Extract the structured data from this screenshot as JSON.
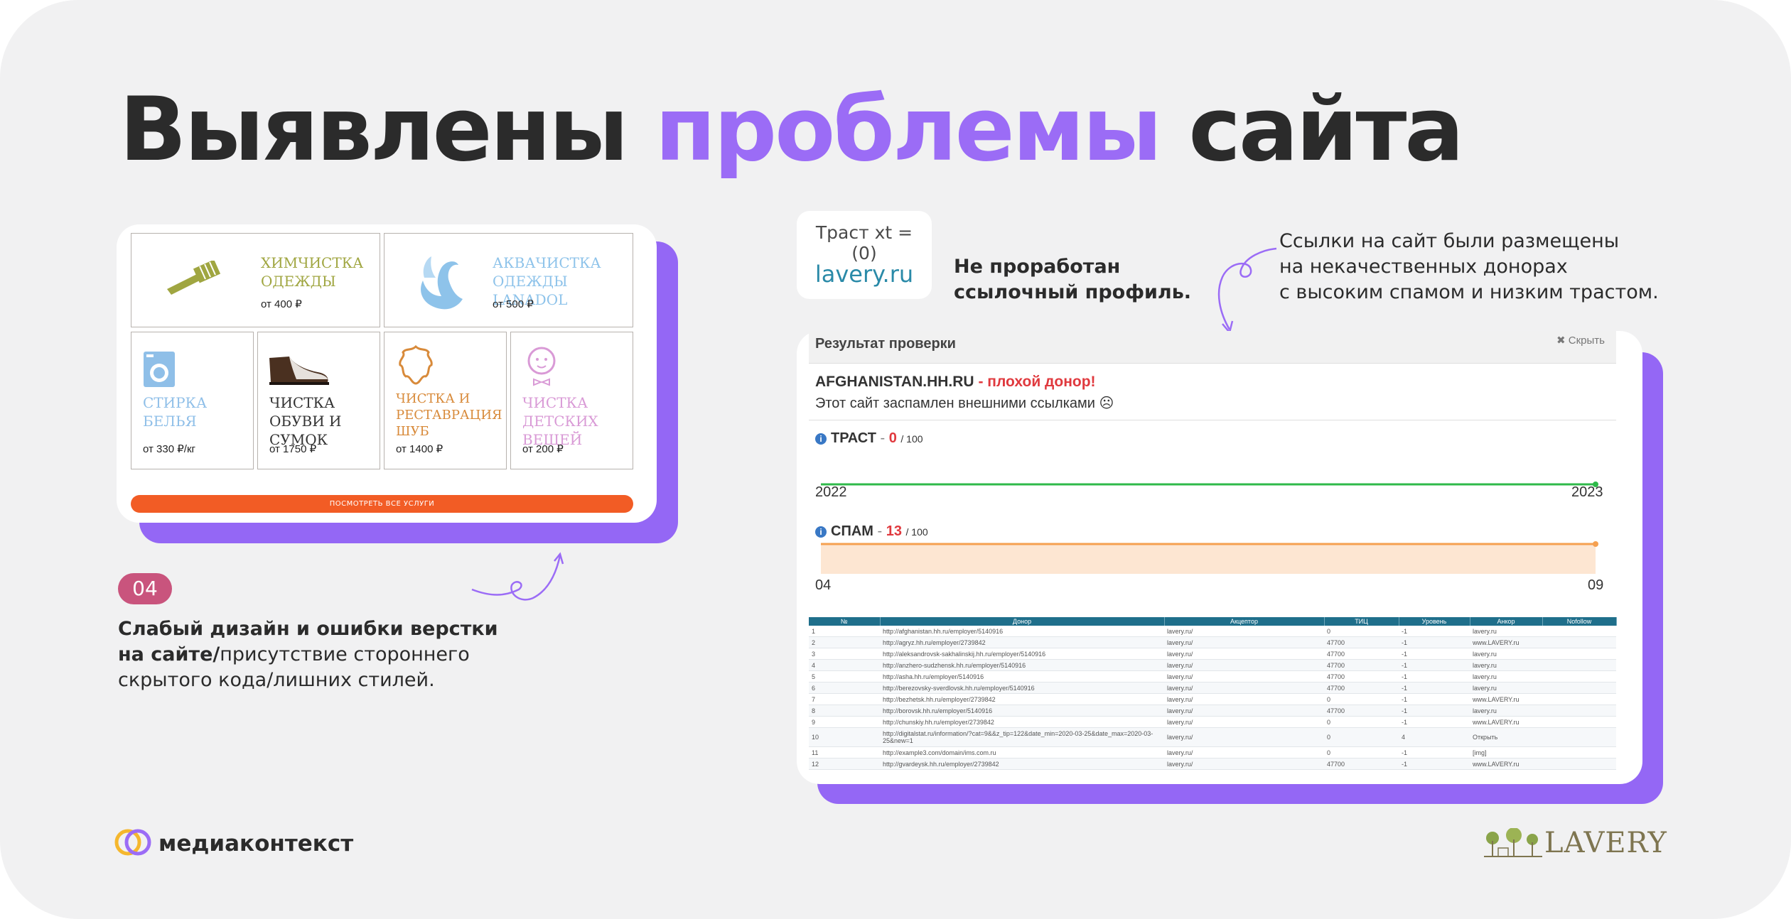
{
  "colors": {
    "background": "#f1f1f2",
    "accent": "#9b6cf6",
    "plate": "#9467f5",
    "badge": "#c9547d",
    "orange_button": "#f25c25",
    "bad": "#e0393e",
    "trust_line": "#2fba4a",
    "spam_line": "#f5a050",
    "spam_fill": "#fde6d2",
    "table_header": "#1f6f8b"
  },
  "heading": {
    "part1": "Выявлены ",
    "accent": "проблемы",
    "part2": " сайта"
  },
  "services": {
    "items": [
      {
        "name_line1": "ХИМЧИСТКА",
        "name_line2": "ОДЕЖДЫ",
        "price": "от 400 ₽",
        "color": "#a0a641",
        "icon": "brush-icon"
      },
      {
        "name_line1": "АКВАЧИСТКА",
        "name_line2": "ОДЕЖДЫ Lanadol",
        "price": "от 500 ₽",
        "color": "#8ec3ea",
        "icon": "swan-icon"
      },
      {
        "name_line1": "СТИРКА",
        "name_line2": "БЕЛЬЯ",
        "price": "от 330 ₽/кг",
        "color": "#8fbfe8",
        "icon": "washing-machine-icon"
      },
      {
        "name_line1": "ЧИСТКА",
        "name_line2": "ОБУВИ и СУМОК",
        "price": "от 1750 ₽",
        "color": "#333333",
        "icon": "shoe-icon"
      },
      {
        "name_line1": "ЧИСТКА И",
        "name_line2": "РЕСТАВРАЦИЯ",
        "name_line3": "ШУБ",
        "price": "от 1400 ₽",
        "color": "#d88a3a",
        "icon": "fur-hide-icon"
      },
      {
        "name_line1": "ЧИСТКА",
        "name_line2": "ДЕТСКИХ ВЕЩЕЙ",
        "price": "от 200 ₽",
        "color": "#d99ad6",
        "icon": "baby-icon"
      }
    ],
    "button_label": "ПОСМОТРЕТЬ ВСЕ УСЛУГИ"
  },
  "badge": "04",
  "desc": {
    "bold": "Слабый дизайн и ошибки верстки на сайте/",
    "normal": "присутствие стороннего скрытого кода/лишних стилей."
  },
  "trust": {
    "label": "Траст xt = (0)",
    "domain": "lavery.ru"
  },
  "profile": {
    "line1": "Не проработан",
    "line2": "ссылочный профиль."
  },
  "links_note": {
    "line1": "Ссылки на сайт были размещены",
    "line2": "на некачественных донорах",
    "line3": "с высоким спамом и низким трастом."
  },
  "check": {
    "title": "Результат проверки",
    "hide": "✖ Скрыть",
    "domain": "AFGHANISTAN.HH.RU",
    "sep": " - ",
    "verdict": "плохой донор!",
    "note": "Этот сайт заспамлен внешними ссылками ☹"
  },
  "chart_data": [
    {
      "type": "line",
      "title": "ТРАСТ",
      "value": "0",
      "max": "/ 100",
      "x": [
        "2022",
        "2023"
      ],
      "values": [
        0,
        0
      ],
      "ylim": [
        0,
        100
      ]
    },
    {
      "type": "area",
      "title": "СПАМ",
      "value": "13",
      "max": "/ 100",
      "x": [
        "04",
        "09"
      ],
      "values": [
        13,
        13
      ],
      "ylim": [
        0,
        100
      ]
    }
  ],
  "table": {
    "headers": [
      "№",
      "Донор",
      "Акцептор",
      "ТИЦ",
      "Уровень",
      "Анкор",
      "Nofollow"
    ],
    "rows": [
      [
        "1",
        "http://afghanistan.hh.ru/employer/5140916",
        "lavery.ru/",
        "0",
        "-1",
        "lavery.ru",
        ""
      ],
      [
        "2",
        "http://agryz.hh.ru/employer/2739842",
        "lavery.ru/",
        "47700",
        "-1",
        "www.LAVERY.ru",
        ""
      ],
      [
        "3",
        "http://aleksandrovsk-sakhalinskij.hh.ru/employer/5140916",
        "lavery.ru/",
        "47700",
        "-1",
        "lavery.ru",
        ""
      ],
      [
        "4",
        "http://anzhero-sudzhensk.hh.ru/employer/5140916",
        "lavery.ru/",
        "47700",
        "-1",
        "lavery.ru",
        ""
      ],
      [
        "5",
        "http://asha.hh.ru/employer/5140916",
        "lavery.ru/",
        "47700",
        "-1",
        "lavery.ru",
        ""
      ],
      [
        "6",
        "http://berezovsky-sverdlovsk.hh.ru/employer/5140916",
        "lavery.ru/",
        "47700",
        "-1",
        "lavery.ru",
        ""
      ],
      [
        "7",
        "http://bezhetsk.hh.ru/employer/2739842",
        "lavery.ru/",
        "0",
        "-1",
        "www.LAVERY.ru",
        ""
      ],
      [
        "8",
        "http://borovsk.hh.ru/employer/5140916",
        "lavery.ru/",
        "47700",
        "-1",
        "lavery.ru",
        ""
      ],
      [
        "9",
        "http://chunskiy.hh.ru/employer/2739842",
        "lavery.ru/",
        "0",
        "-1",
        "www.LAVERY.ru",
        ""
      ],
      [
        "10",
        "http://digitalstat.ru/information/?cat=9&&z_tip=122&date_min=2020-03-25&date_max=2020-03-25&new=1",
        "lavery.ru/",
        "0",
        "4",
        "Открыть",
        ""
      ],
      [
        "11",
        "http://example3.com/domain/ims.com.ru",
        "lavery.ru/",
        "0",
        "-1",
        "[img]",
        ""
      ],
      [
        "12",
        "http://gvardeysk.hh.ru/employer/2739842",
        "lavery.ru/",
        "47700",
        "-1",
        "www.LAVERY.ru",
        ""
      ]
    ]
  },
  "footer": {
    "brand": "медиаконтекст",
    "logo": "LAVERY"
  }
}
